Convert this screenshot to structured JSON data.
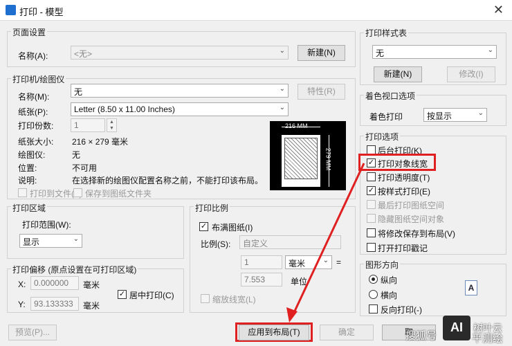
{
  "window": {
    "title": "打印 - 模型"
  },
  "page_setup": {
    "group_label": "页面设置",
    "name_label": "名称(A):",
    "name_value": "<无>",
    "new_button": "新建(N)"
  },
  "printer": {
    "group_label": "打印机/绘图仪",
    "name_label": "名称(M):",
    "name_value": "无",
    "properties_button": "特性(R)",
    "paper_label": "纸张(P):",
    "paper_value": "Letter (8.50 x 11.00 Inches)",
    "copies_label": "打印份数:",
    "copies_value": "1",
    "size_label": "纸张大小:",
    "size_value": "216 × 279  毫米",
    "plotter_label": "绘图仪:",
    "plotter_value": "无",
    "location_label": "位置:",
    "location_value": "不可用",
    "description_label": "说明:",
    "description_value": "在选择新的绘图仪配置名称之前，不能打印该布局。",
    "print_to_file": "打印到文件(F)",
    "save_to_paper_folder": "保存到图纸文件夹",
    "preview_width": "216 MM",
    "preview_height": "279 MM"
  },
  "plot_area": {
    "group_label": "打印区域",
    "range_label": "打印范围(W):",
    "range_value": "显示"
  },
  "plot_offset": {
    "group_label": "打印偏移 (原点设置在可打印区域)",
    "x_label": "X:",
    "x_value": "0.000000",
    "y_label": "Y:",
    "y_value": "93.133333",
    "unit": "毫米",
    "center_plot": "居中打印(C)"
  },
  "plot_scale": {
    "group_label": "打印比例",
    "fit_to_paper": "布满图纸(I)",
    "scale_label": "比例(S):",
    "scale_value": "自定义",
    "value1": "1",
    "unit1": "毫米",
    "equals": "=",
    "value2": "7.553",
    "unit2_label": "单位",
    "scale_lineweights": "缩放线宽(L)"
  },
  "style_table": {
    "group_label": "打印样式表",
    "value": "无",
    "new_button": "新建(N)",
    "modify_button": "修改(I)"
  },
  "shaded_viewport": {
    "group_label": "着色视口选项",
    "shade_label": "着色打印",
    "shade_value": "按显示"
  },
  "plot_options": {
    "group_label": "打印选项",
    "background": "后台打印(K)",
    "object_lineweights": "打印对象线宽",
    "transparency": "打印透明度(T)",
    "plot_with_styles": "按样式打印(E)",
    "paperspace_last": "最后打印图纸空间",
    "hide_paperspace": "隐藏图纸空间对象",
    "save_changes": "将修改保存到布局(V)",
    "plot_stamp": "打开打印戳记"
  },
  "orientation": {
    "group_label": "图形方向",
    "portrait": "纵向",
    "landscape": "横向",
    "upside_down": "反向打印(-)",
    "icon_letter": "A"
  },
  "footer": {
    "preview_button": "预览(P)...",
    "apply_button": "应用到布局(T)",
    "ok_button": "确定",
    "cancel_button": "取",
    "watermark_left": "搜狐号",
    "watermark_right": "平测绘",
    "watermark_logo": "AI",
    "watermark_brand": "树叶云"
  },
  "colors": {
    "highlight": "#e02020",
    "accent": "#1e6fd0"
  }
}
